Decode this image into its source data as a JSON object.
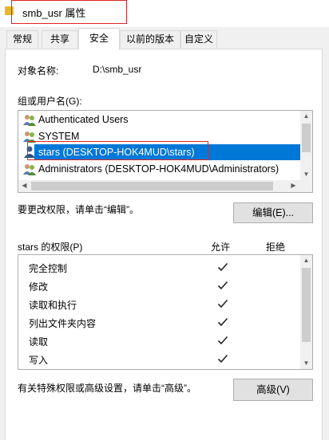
{
  "window": {
    "title": "smb_usr 属性"
  },
  "tabs": [
    {
      "label": "常规"
    },
    {
      "label": "共享"
    },
    {
      "label": "安全"
    },
    {
      "label": "以前的版本"
    },
    {
      "label": "自定义"
    }
  ],
  "object": {
    "label": "对象名称:",
    "value": "D:\\smb_usr"
  },
  "groups": {
    "label": "组或用户名(G):",
    "items": [
      {
        "label": "Authenticated Users",
        "icon": "users-icon"
      },
      {
        "label": "SYSTEM",
        "icon": "users-icon"
      },
      {
        "label": "stars (DESKTOP-HOK4MUD\\stars)",
        "icon": "user-icon",
        "selected": true
      },
      {
        "label": "Administrators (DESKTOP-HOK4MUD\\Administrators)",
        "icon": "users-icon"
      }
    ]
  },
  "edit": {
    "hint": "要更改权限，请单击“编辑”。",
    "button": "编辑(E)..."
  },
  "permissions": {
    "header": "stars 的权限(P)",
    "allow_header": "允许",
    "deny_header": "拒绝",
    "rows": [
      {
        "name": "完全控制",
        "allow": true,
        "deny": false
      },
      {
        "name": "修改",
        "allow": true,
        "deny": false
      },
      {
        "name": "读取和执行",
        "allow": true,
        "deny": false
      },
      {
        "name": "列出文件夹内容",
        "allow": true,
        "deny": false
      },
      {
        "name": "读取",
        "allow": true,
        "deny": false
      },
      {
        "name": "写入",
        "allow": true,
        "deny": false
      }
    ]
  },
  "advanced": {
    "hint": "有关特殊权限或高级设置，请单击“高级”。",
    "button": "高级(V)"
  },
  "colors": {
    "selection": "#0078d7",
    "highlight_box": "#e02424",
    "folder": "#e8b72c"
  }
}
